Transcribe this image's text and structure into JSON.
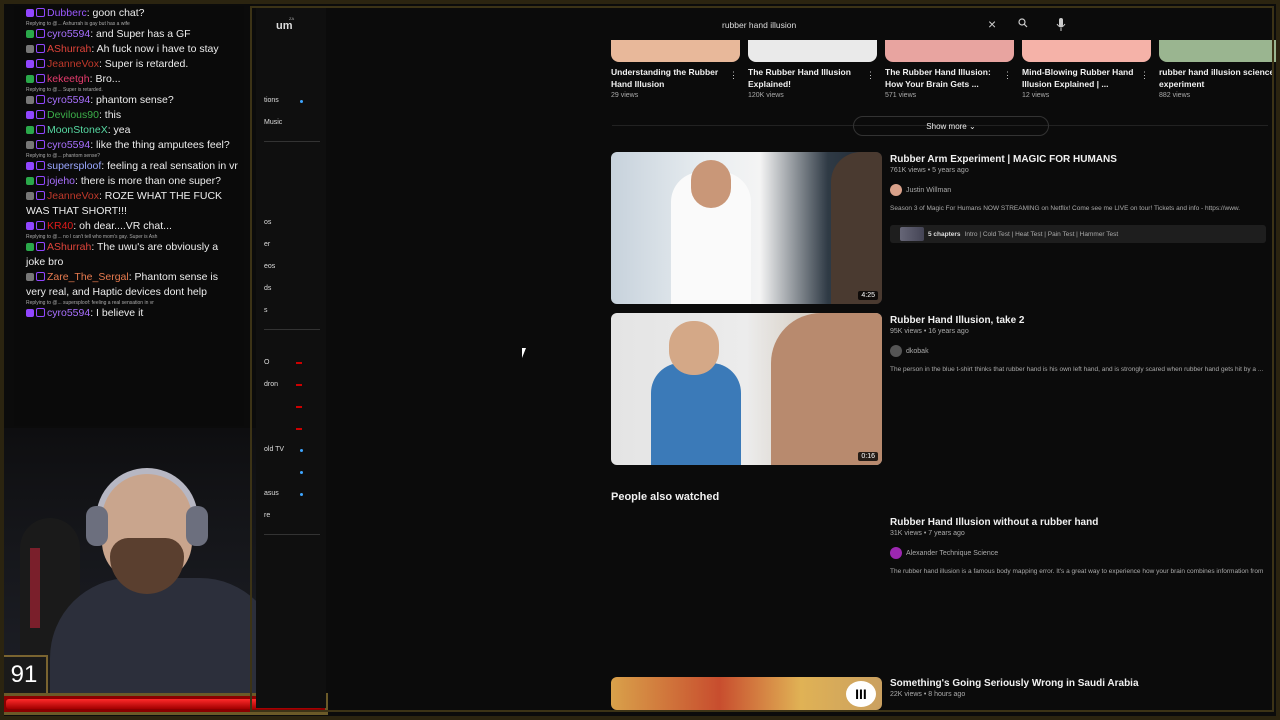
{
  "chat": {
    "messages": [
      {
        "user": "Dubberc",
        "text": ": goon chat?",
        "color": "#9b59ff",
        "reply": ""
      },
      {
        "user": "cyro5594",
        "text": ": and Super has a GF",
        "color": "#a970ff",
        "reply": "Replying to @... Ashurrah is gay but has a wife"
      },
      {
        "user": "AShurrah",
        "text": ": Ah fuck now i have to stay",
        "color": "#e0443a",
        "reply": ""
      },
      {
        "user": "JeanneVox",
        "text": ": Super is retarded.",
        "color": "#c0392b",
        "reply": ""
      },
      {
        "user": "kekeetgh",
        "text": ": Bro...",
        "color": "#e53b6d",
        "reply": ""
      },
      {
        "user": "cyro5594",
        "text": ": phantom sense?",
        "color": "#a970ff",
        "reply": "Replying to @... Super is retarded."
      },
      {
        "user": "Devilous90",
        "text": ": this",
        "color": "#3cb04a",
        "reply": ""
      },
      {
        "user": "MoonStoneX",
        "text": ": yea",
        "color": "#57d9a3",
        "reply": ""
      },
      {
        "user": "cyro5594",
        "text": ": like the thing amputees feel?",
        "color": "#a970ff",
        "reply": ""
      },
      {
        "user": "supersploof",
        "text": ": feeling a real sensation in vr",
        "color": "#9aa7ff",
        "reply": "Replying to @... phantom sense?"
      },
      {
        "user": "jojeho",
        "text": ": there is more than one super?",
        "color": "#a970ff",
        "reply": ""
      },
      {
        "user": "JeanneVox",
        "text": ": ROZE WHAT THE FUCK WAS THAT SHORT!!!",
        "color": "#c0392b",
        "reply": ""
      },
      {
        "user": "KR40",
        "text": ": oh dear....VR chat...",
        "color": "#e01b1b",
        "reply": ""
      },
      {
        "user": "AShurrah",
        "text": ": The uwu's are obviously a joke bro",
        "color": "#e0443a",
        "reply": "Replying to @... no I can't tell who mom's gay. Super is Ash"
      },
      {
        "user": "Zare_The_Sergal",
        "text": ": Phantom sense is very real, and Haptic devices dont help",
        "color": "#e87b4f",
        "reply": ""
      },
      {
        "user": "cyro5594",
        "text": ": I believe it",
        "color": "#a970ff",
        "reply": "Replying to @... supersploof: feeling a real sensation in vr"
      }
    ]
  },
  "overlay": {
    "counter": "91"
  },
  "youtube": {
    "logo_text": "um",
    "logo_super": "ZA",
    "search_query": "rubber hand illusion",
    "nav_labels": [
      "tions",
      "Music",
      "os",
      "er",
      "eos",
      "ds",
      "s",
      "O",
      "dron",
      "old TV",
      "asus",
      "re"
    ],
    "shelf": [
      {
        "title": "Understanding the Rubber Hand Illusion",
        "views": "29 views",
        "color": "#e8b89a"
      },
      {
        "title": "The Rubber Hand Illusion Explained!",
        "views": "120K views",
        "color": "#eaeaea"
      },
      {
        "title": "The Rubber Hand Illusion: How Your Brain Gets ...",
        "views": "571 views",
        "color": "#e8a4a0"
      },
      {
        "title": "Mind-Blowing Rubber Hand Illusion Explained | ...",
        "views": "12 views",
        "color": "#f5b2a8"
      },
      {
        "title": "rubber hand illusion science experiment",
        "views": "882 views",
        "color": "#9ab590"
      }
    ],
    "show_more": "Show more",
    "videos": [
      {
        "title": "Rubber Arm Experiment | MAGIC FOR HUMANS",
        "meta": "761K views • 5 years ago",
        "channel": "Justin Willman",
        "desc": "Season 3 of Magic For Humans NOW STREAMING on Netflix! Come see me LIVE on tour! Tickets and info - https://www.",
        "duration": "4:25",
        "chapters": "5 chapters",
        "chapter_list": "Intro | Cold Test | Heat Test | Pain Test | Hammer Test"
      },
      {
        "title": "Rubber Hand Illusion, take 2",
        "meta": "95K views • 16 years ago",
        "channel": "dkobak",
        "desc": "The person in the blue t-shirt thinks that rubber hand is his own left hand, and is strongly scared when rubber hand gets hit by a ...",
        "duration": "0:16"
      }
    ],
    "people_also_watched": "People also watched",
    "more_videos": [
      {
        "title": "Rubber Hand Illusion without a rubber hand",
        "meta": "31K views • 7 years ago",
        "channel": "Alexander Technique Science",
        "desc": "The rubber hand illusion is a famous body mapping error. It's a great way to experience how your brain combines information from"
      },
      {
        "title": "Something's Going Seriously Wrong in Saudi Arabia",
        "meta": "22K views • 8 hours ago"
      }
    ]
  }
}
